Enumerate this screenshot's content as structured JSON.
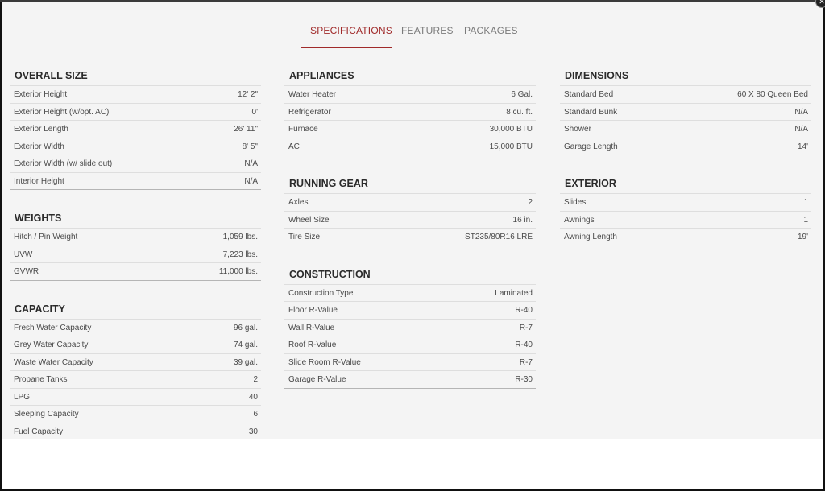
{
  "tabs": [
    {
      "label": "SPECIFICATIONS"
    },
    {
      "label": "FEATURES"
    },
    {
      "label": "PACKAGES"
    }
  ],
  "columns": [
    [
      {
        "title": "OVERALL SIZE",
        "rows": [
          {
            "label": "Exterior Height",
            "value": "12' 2\""
          },
          {
            "label": "Exterior Height (w/opt. AC)",
            "value": "0'"
          },
          {
            "label": "Exterior Length",
            "value": "26' 11\""
          },
          {
            "label": "Exterior Width",
            "value": "8' 5\""
          },
          {
            "label": "Exterior Width (w/ slide out)",
            "value": "N/A"
          },
          {
            "label": "Interior Height",
            "value": "N/A"
          }
        ]
      },
      {
        "title": "WEIGHTS",
        "rows": [
          {
            "label": "Hitch / Pin Weight",
            "value": "1,059 lbs."
          },
          {
            "label": "UVW",
            "value": "7,223 lbs."
          },
          {
            "label": "GVWR",
            "value": "11,000 lbs."
          }
        ]
      },
      {
        "title": "CAPACITY",
        "rows": [
          {
            "label": "Fresh Water Capacity",
            "value": "96 gal."
          },
          {
            "label": "Grey Water Capacity",
            "value": "74 gal."
          },
          {
            "label": "Waste Water Capacity",
            "value": "39 gal."
          },
          {
            "label": "Propane Tanks",
            "value": "2"
          },
          {
            "label": "LPG",
            "value": "40"
          },
          {
            "label": "Sleeping Capacity",
            "value": "6"
          },
          {
            "label": "Fuel Capacity",
            "value": "30"
          }
        ]
      }
    ],
    [
      {
        "title": "APPLIANCES",
        "rows": [
          {
            "label": "Water Heater",
            "value": "6 Gal."
          },
          {
            "label": "Refrigerator",
            "value": "8 cu. ft."
          },
          {
            "label": "Furnace",
            "value": "30,000 BTU"
          },
          {
            "label": "AC",
            "value": "15,000 BTU"
          }
        ]
      },
      {
        "title": "RUNNING GEAR",
        "rows": [
          {
            "label": "Axles",
            "value": "2"
          },
          {
            "label": "Wheel Size",
            "value": "16 in."
          },
          {
            "label": "Tire Size",
            "value": "ST235/80R16 LRE"
          }
        ]
      },
      {
        "title": "CONSTRUCTION",
        "rows": [
          {
            "label": "Construction Type",
            "value": "Laminated"
          },
          {
            "label": "Floor R-Value",
            "value": "R-40"
          },
          {
            "label": "Wall R-Value",
            "value": "R-7"
          },
          {
            "label": "Roof R-Value",
            "value": "R-40"
          },
          {
            "label": "Slide Room R-Value",
            "value": "R-7"
          },
          {
            "label": "Garage R-Value",
            "value": "R-30"
          }
        ]
      }
    ],
    [
      {
        "title": "DIMENSIONS",
        "rows": [
          {
            "label": "Standard Bed",
            "value": "60 X 80 Queen Bed"
          },
          {
            "label": "Standard Bunk",
            "value": "N/A"
          },
          {
            "label": "Shower",
            "value": "N/A"
          },
          {
            "label": "Garage Length",
            "value": "14'"
          }
        ]
      },
      {
        "title": "EXTERIOR",
        "rows": [
          {
            "label": "Slides",
            "value": "1"
          },
          {
            "label": "Awnings",
            "value": "1"
          },
          {
            "label": "Awning Length",
            "value": "19'"
          }
        ]
      }
    ]
  ],
  "colors": {
    "accent": "#a02a2a",
    "text": "#4a4a4a",
    "divider": "#dedede"
  },
  "icons": {
    "close": "close-icon"
  }
}
